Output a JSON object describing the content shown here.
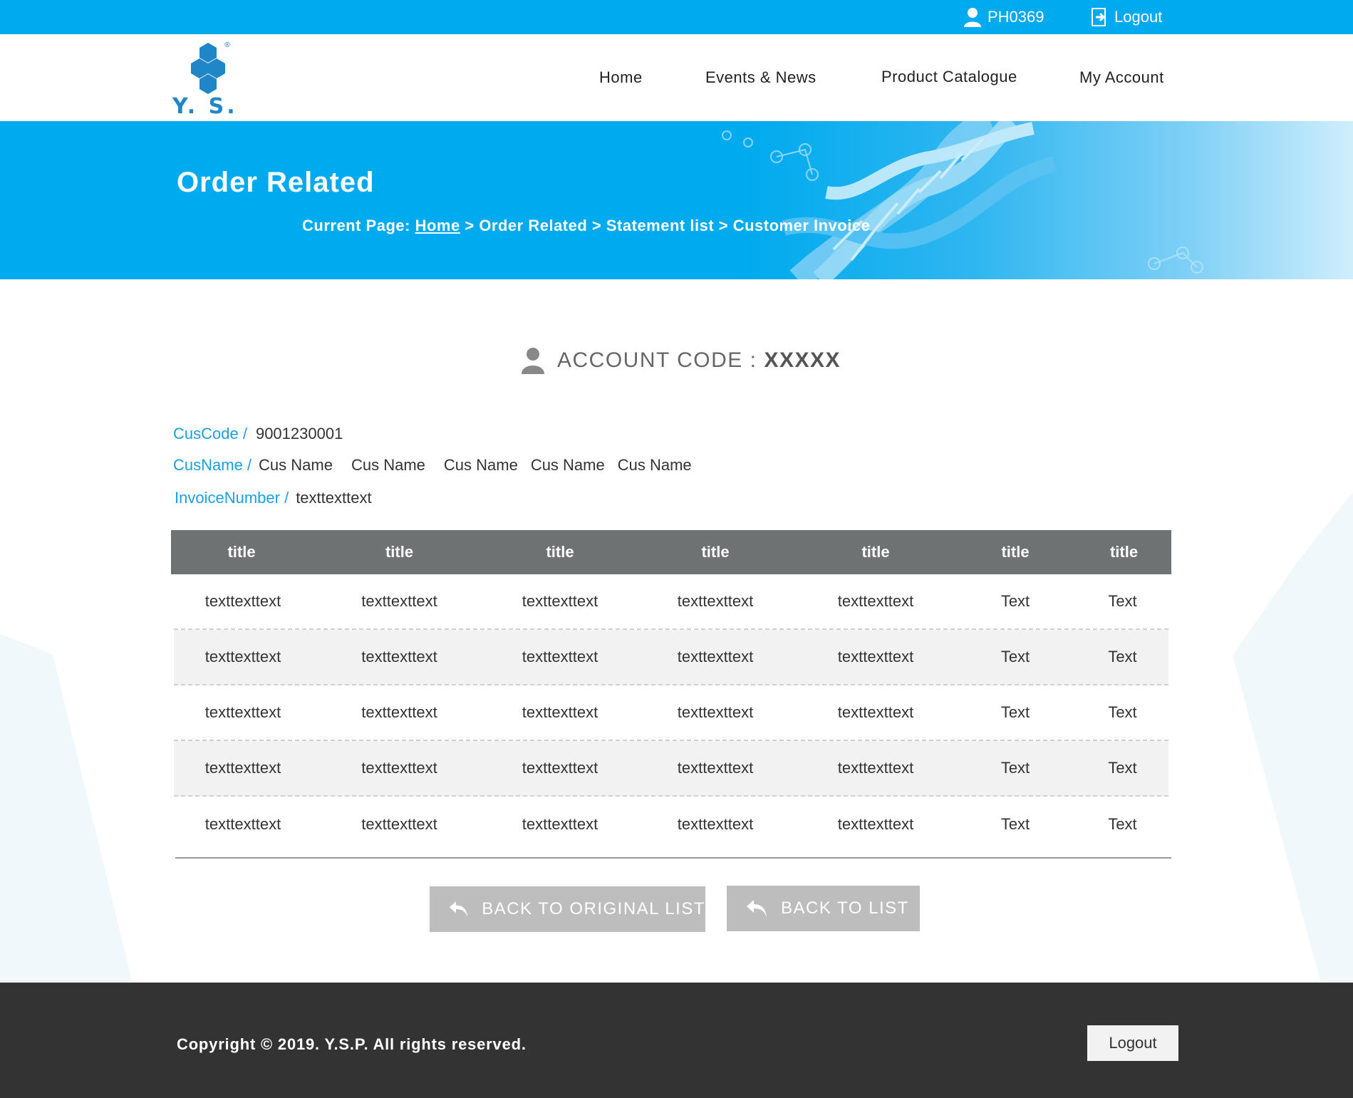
{
  "topbar": {
    "user_code": "PH0369",
    "logout_label": "Logout"
  },
  "header": {
    "logo_text": "Y. S. P.",
    "logo_mark": "®",
    "nav": [
      "Home",
      "Events & News",
      "Product Catalogue",
      "My Account"
    ]
  },
  "banner": {
    "title": "Order Related",
    "breadcrumb_prefix": "Current Page:",
    "breadcrumb_home": "Home",
    "breadcrumb_rest": "> Order Related > Statement list > Customer Invoice"
  },
  "account": {
    "label": "ACCOUNT CODE :",
    "value": "XXXXX"
  },
  "info": {
    "cuscode_label": "CusCode /",
    "cuscode_value": "9001230001",
    "cusname_label": "CusName /",
    "cusname_values": [
      "Cus Name",
      "Cus Name",
      "Cus Name",
      "Cus Name",
      "Cus Name"
    ],
    "invoice_label": "InvoiceNumber /",
    "invoice_value": "texttexttext"
  },
  "table": {
    "headers": [
      "title",
      "title",
      "title",
      "title",
      "title",
      "title",
      "title"
    ],
    "rows": [
      [
        "texttexttext",
        "texttexttext",
        "texttexttext",
        "texttexttext",
        "texttexttext",
        "Text",
        "Text"
      ],
      [
        "texttexttext",
        "texttexttext",
        "texttexttext",
        "texttexttext",
        "texttexttext",
        "Text",
        "Text"
      ],
      [
        "texttexttext",
        "texttexttext",
        "texttexttext",
        "texttexttext",
        "texttexttext",
        "Text",
        "Text"
      ],
      [
        "texttexttext",
        "texttexttext",
        "texttexttext",
        "texttexttext",
        "texttexttext",
        "Text",
        "Text"
      ],
      [
        "texttexttext",
        "texttexttext",
        "texttexttext",
        "texttexttext",
        "texttexttext",
        "Text",
        "Text"
      ]
    ]
  },
  "buttons": {
    "back_original": "BACK TO ORIGINAL LIST",
    "back_list": "BACK TO LIST"
  },
  "footer": {
    "copyright": "Copyright © 2019. Y.S.P. All rights reserved.",
    "logout_label": "Logout"
  },
  "colors": {
    "brand_blue": "#00aaee",
    "label_blue": "#1aa0e2",
    "table_header": "#6f7273",
    "button_gray": "#bdbdbd",
    "footer_bg": "#333333"
  },
  "icons": [
    "user-icon",
    "logout-icon",
    "logo-hexagon-icon",
    "dna-decoration",
    "account-user-icon",
    "back-arrow-icon"
  ]
}
